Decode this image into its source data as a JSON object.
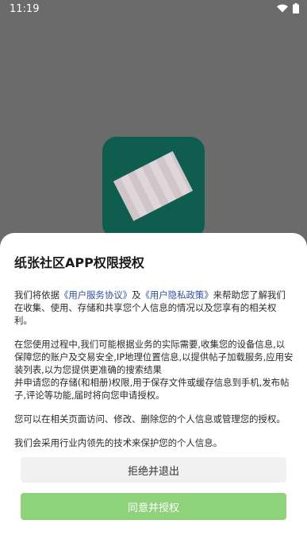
{
  "status_bar": {
    "time": "11:19",
    "icons": [
      "wifi-icon",
      "battery-icon"
    ]
  },
  "app_icon": {
    "name": "app-icon"
  },
  "dialog": {
    "title": "纸张社区APP权限授权",
    "p1": {
      "pre": "我们将依据",
      "link1": "《用户服务协议》",
      "mid": "及",
      "link2": "《用户隐私政策》",
      "post": "来帮助您了解我们在收集、使用、存储和共享您个人信息的情况以及您享有的相关权利。"
    },
    "p2": "在您使用过程中,我们可能根据业务的实际需要,收集您的设备信息,以保障您的账户及交易安全,IP地理位置信息,以提供帖子加载服务,应用安装列表,以为您提供更准确的搜索结果",
    "p2b": "并申请您的存储(和相册)权限,用于保存文件或缓存信息到手机,发布帖子,评论等功能,届时将向您申请授权。",
    "p3": "您可以在相关页面访问、修改、删除您的个人信息或管理您的授权。",
    "p4": "我们会采用行业内领先的技术来保护您的个人信息。",
    "reject_label": "拒绝并退出",
    "agree_label": "同意并授权"
  },
  "colors": {
    "overlay": "#6b6b6b",
    "app_tile": "#0e5d4f",
    "link": "#2f4fa6",
    "agree_button": "#8ed27a",
    "reject_button": "#f1f1f1"
  }
}
